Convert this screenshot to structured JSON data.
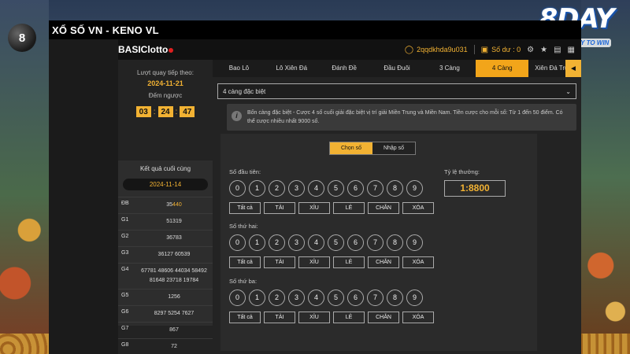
{
  "window_title": "XỔ SỐ VN - KENO VL",
  "background_ball": "8",
  "brand": {
    "name": "8DAY",
    "slogan": "START A DAY TO WIN"
  },
  "app": {
    "logo_part1": "BASIC",
    "logo_part2": "lotto",
    "username": "2qqdkhda9u031",
    "balance_label": "Số dư : 0",
    "icons": [
      "user-icon",
      "wallet-icon",
      "settings-icon",
      "trophy-icon",
      "history-icon",
      "document-icon"
    ]
  },
  "left": {
    "next_draw_label": "Lượt quay tiếp theo:",
    "next_draw_date": "2024-11-21",
    "countdown_label": "Đếm ngược",
    "countdown": {
      "h": "03",
      "m": "24",
      "s": "47"
    },
    "last_result_label": "Kết quả cuối cùng",
    "last_result_date": "2024-11-14",
    "results": [
      {
        "label": "ĐB",
        "lines": [
          "35"
        ],
        "highlight": "440"
      },
      {
        "label": "G1",
        "lines": [
          "51319"
        ]
      },
      {
        "label": "G2",
        "lines": [
          "36783"
        ]
      },
      {
        "label": "G3",
        "lines": [
          "36127 60539"
        ]
      },
      {
        "label": "G4",
        "lines": [
          "67781 48606 44034 58492",
          "81648 23718 19784"
        ]
      },
      {
        "label": "G5",
        "lines": [
          "1256"
        ]
      },
      {
        "label": "G6",
        "lines": [
          "8297 5254 7627"
        ]
      },
      {
        "label": "G7",
        "lines": [
          "867"
        ]
      },
      {
        "label": "G8",
        "lines": [
          "72"
        ]
      }
    ]
  },
  "tabs": [
    "Bao Lô",
    "Lô Xiên Đá",
    "Đánh Đề",
    "Đầu Đuôi",
    "3 Càng",
    "4 Càng",
    "Xiên Đá Trượt"
  ],
  "active_tab": "4 Càng",
  "bet_type_selected": "4 càng đặc biệt",
  "info_text": "Bốn càng đặc biệt - Cược 4 số cuối giải đặc biệt vị trí giải Miền Trung và Miền Nam. Tiền cược cho mỗi số: Từ 1 đến 50 điểm. Có thể cược nhiều nhất 9000 số.",
  "mode": {
    "choose": "Chọn số",
    "input": "Nhập số"
  },
  "rate": {
    "label": "Tỷ lệ thưởng:",
    "value": "1:8800"
  },
  "digit_rows": [
    {
      "label": "Số đầu tiên:"
    },
    {
      "label": "Số thứ hai:"
    },
    {
      "label": "Số thứ ba:"
    }
  ],
  "digits": [
    "0",
    "1",
    "2",
    "3",
    "4",
    "5",
    "6",
    "7",
    "8",
    "9"
  ],
  "quick_buttons": [
    "Tất cả",
    "TÀI",
    "XỈU",
    "LẺ",
    "CHẴN",
    "XÓA"
  ]
}
